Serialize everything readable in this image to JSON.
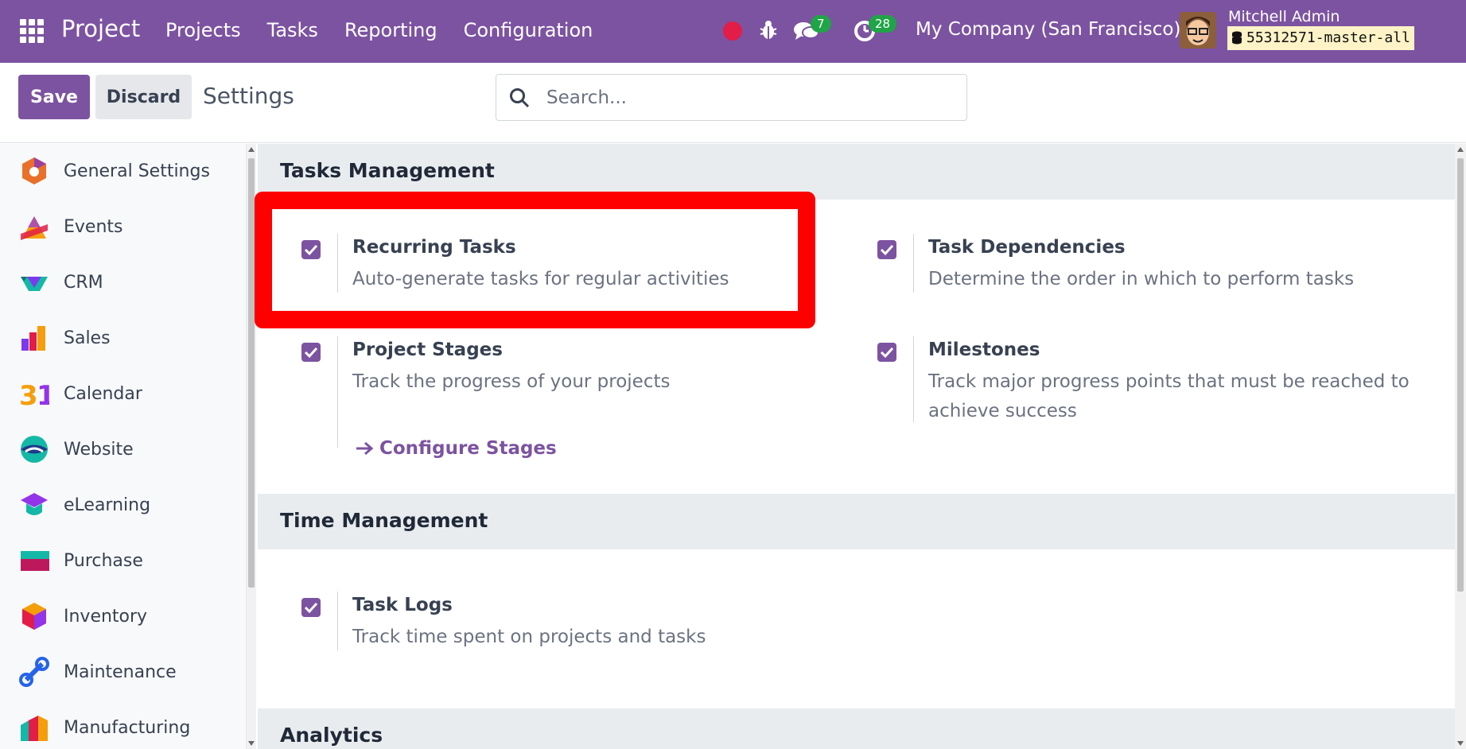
{
  "navbar": {
    "app_title": "Project",
    "menu": [
      "Projects",
      "Tasks",
      "Reporting",
      "Configuration"
    ],
    "messages_count": "7",
    "activities_count": "28",
    "company": "My Company (San Francisco)",
    "user_name": "Mitchell Admin",
    "database": "55312571-master-all",
    "accent_color": "#7c53a1"
  },
  "control": {
    "save_label": "Save",
    "discard_label": "Discard",
    "breadcrumb": "Settings",
    "search_placeholder": "Search..."
  },
  "sidebar": {
    "items": [
      {
        "label": "General Settings",
        "icon": "general-settings-icon"
      },
      {
        "label": "Events",
        "icon": "events-icon"
      },
      {
        "label": "CRM",
        "icon": "crm-icon"
      },
      {
        "label": "Sales",
        "icon": "sales-icon"
      },
      {
        "label": "Calendar",
        "icon": "calendar-icon"
      },
      {
        "label": "Website",
        "icon": "website-icon"
      },
      {
        "label": "eLearning",
        "icon": "elearning-icon"
      },
      {
        "label": "Purchase",
        "icon": "purchase-icon"
      },
      {
        "label": "Inventory",
        "icon": "inventory-icon"
      },
      {
        "label": "Maintenance",
        "icon": "maintenance-icon"
      },
      {
        "label": "Manufacturing",
        "icon": "manufacturing-icon"
      }
    ]
  },
  "sections": {
    "tasks_management": {
      "title": "Tasks Management",
      "recurring": {
        "title": "Recurring Tasks",
        "desc": "Auto-generate tasks for regular activities",
        "checked": true
      },
      "dependencies": {
        "title": "Task Dependencies",
        "desc": "Determine the order in which to perform tasks",
        "checked": true
      },
      "stages": {
        "title": "Project Stages",
        "desc": "Track the progress of your projects",
        "link": "Configure Stages",
        "checked": true
      },
      "milestones": {
        "title": "Milestones",
        "desc": "Track major progress points that must be reached to achieve success",
        "checked": true
      }
    },
    "time_management": {
      "title": "Time Management",
      "task_logs": {
        "title": "Task Logs",
        "desc": "Track time spent on projects and tasks",
        "checked": true
      }
    },
    "analytics": {
      "title": "Analytics"
    }
  }
}
